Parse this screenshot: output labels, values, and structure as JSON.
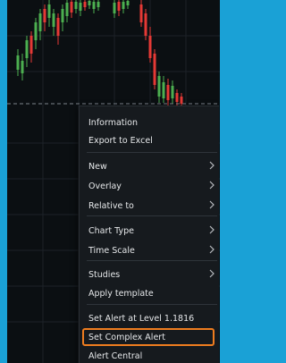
{
  "colors": {
    "frame_border": "#1aa1d6",
    "chart_background": "#0b0f12",
    "candle_up": "#4caf50",
    "candle_down": "#e53935",
    "menu_background": "#161a1e",
    "menu_text": "#e6e8ea",
    "highlight_border": "#ef7d1f"
  },
  "menu": {
    "items": [
      {
        "label": "Information",
        "submenu": false
      },
      {
        "label": "Export to Excel",
        "submenu": false
      },
      {
        "label": "New",
        "submenu": true
      },
      {
        "label": "Overlay",
        "submenu": true
      },
      {
        "label": "Relative to",
        "submenu": true
      },
      {
        "label": "Chart Type",
        "submenu": true
      },
      {
        "label": "Time Scale",
        "submenu": true
      },
      {
        "label": "Studies",
        "submenu": true
      },
      {
        "label": "Apply template",
        "submenu": false
      },
      {
        "label": "Set Alert at Level 1.1816",
        "submenu": false
      },
      {
        "label": "Set Complex Alert",
        "submenu": false,
        "highlighted": true
      },
      {
        "label": "Alert Central",
        "submenu": false
      }
    ],
    "submenu_icon": "chevron-right-icon"
  }
}
